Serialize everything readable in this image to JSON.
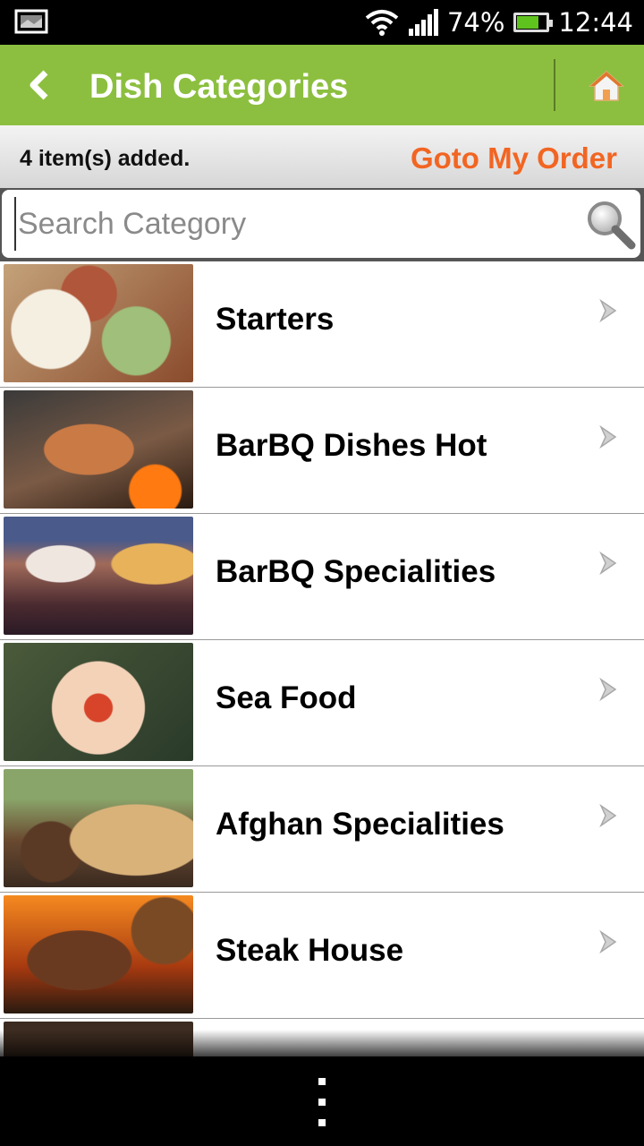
{
  "status_bar": {
    "battery_percent_text": "74%",
    "battery_level": 0.74,
    "time": "12:44",
    "icons": [
      "gallery-icon",
      "wifi-icon",
      "signal-icon",
      "battery-icon"
    ]
  },
  "header": {
    "title": "Dish Categories",
    "back_icon": "chevron-left-icon",
    "home_icon": "home-icon",
    "accent_color": "#8cbf3f"
  },
  "order_bar": {
    "count_text": "4 item(s) added.",
    "goto_label": "Goto My Order",
    "goto_color": "#f26522"
  },
  "search": {
    "placeholder": "Search Category",
    "value": "",
    "icon": "search-icon"
  },
  "categories": [
    {
      "label": "Starters",
      "image": "starters-dish-photo"
    },
    {
      "label": "BarBQ Dishes Hot",
      "image": "grilled-chicken-photo"
    },
    {
      "label": "BarBQ Specialities",
      "image": "barbecue-spread-photo"
    },
    {
      "label": "Sea Food",
      "image": "seafood-platter-photo"
    },
    {
      "label": "Afghan Specialities",
      "image": "afghan-rice-photo"
    },
    {
      "label": "Steak House",
      "image": "grilled-steak-photo"
    },
    {
      "label": "",
      "image": "food-photo"
    }
  ],
  "nav_bar": {
    "menu_icon": "overflow-menu-icon"
  }
}
